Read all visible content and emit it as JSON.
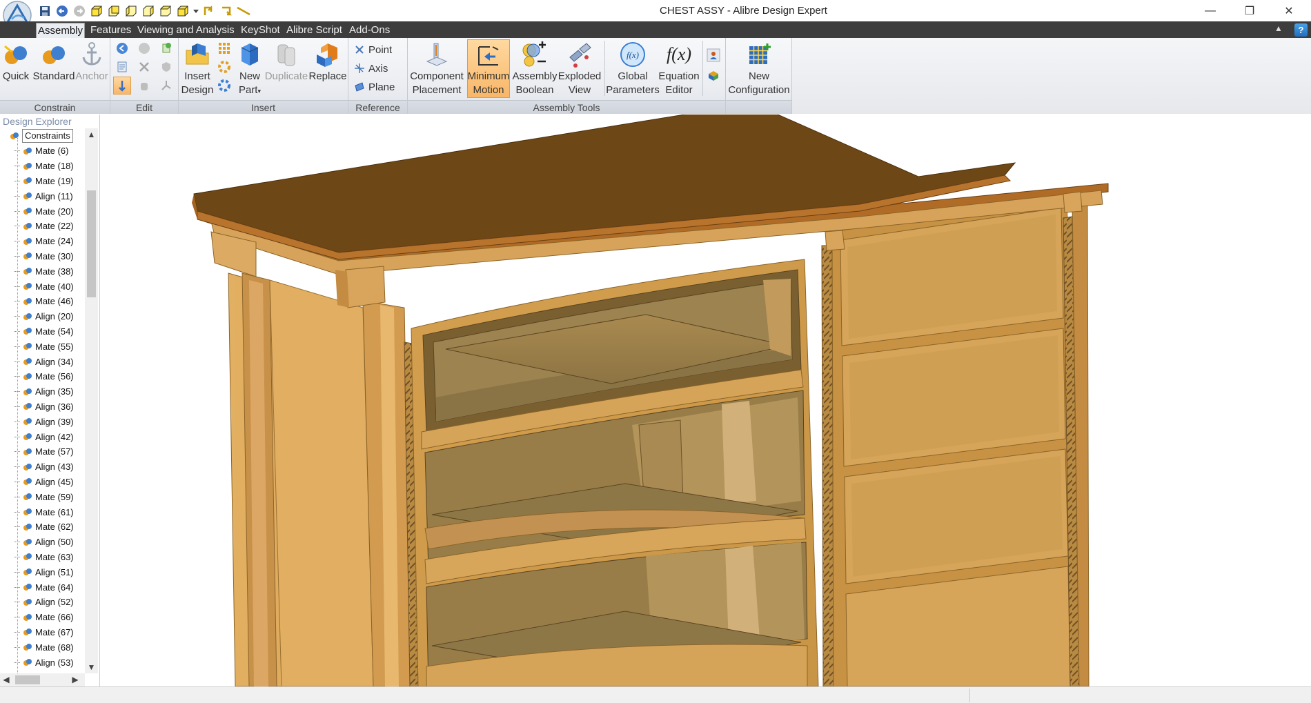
{
  "window": {
    "title": "CHEST ASSY - Alibre Design Expert",
    "minimize_icon": "minimize-icon",
    "restore_icon": "restore-icon",
    "close_icon": "close-icon"
  },
  "quick_access": [
    "save-icon",
    "undo-icon",
    "redo-icon",
    "view-front-icon",
    "view-back-icon",
    "view-left-icon",
    "view-right-icon",
    "view-top-icon",
    "view-iso-icon",
    "dropdown-icon",
    "sketch-icon",
    "arc-icon",
    "line-icon"
  ],
  "ribbon_tabs": [
    "Assembly",
    "Features",
    "Viewing and Analysis",
    "KeyShot",
    "Alibre Script",
    "Add-Ons"
  ],
  "active_tab": "Assembly",
  "ribbon": {
    "constrain": {
      "label": "Constrain",
      "quick": "Quick",
      "standard": "Standard",
      "anchor": "Anchor"
    },
    "edit": {
      "label": "Edit"
    },
    "insert": {
      "label": "Insert",
      "insert_design_1": "Insert",
      "insert_design_2": "Design",
      "new_part_1": "New",
      "new_part_2": "Part",
      "duplicate": "Duplicate",
      "replace": "Replace"
    },
    "reference": {
      "label": "Reference",
      "point": "Point",
      "axis": "Axis",
      "plane": "Plane"
    },
    "assembly_tools": {
      "label": "Assembly Tools",
      "component_placement_1": "Component",
      "component_placement_2": "Placement",
      "minimum_motion_1": "Minimum",
      "minimum_motion_2": "Motion",
      "assembly_boolean_1": "Assembly",
      "assembly_boolean_2": "Boolean",
      "exploded_view_1": "Exploded",
      "exploded_view_2": "View",
      "global_parameters_1": "Global",
      "global_parameters_2": "Parameters",
      "equation_editor_1": "Equation",
      "equation_editor_2": "Editor",
      "equation_icon_text": "f(x)"
    },
    "configuration": {
      "new_configuration_1": "New",
      "new_configuration_2": "Configuration"
    }
  },
  "explorer": {
    "title": "Design Explorer",
    "root": "Constraints",
    "items": [
      "Mate (6)",
      "Mate (18)",
      "Mate (19)",
      "Align (11)",
      "Mate (20)",
      "Mate (22)",
      "Mate (24)",
      "Mate (30)",
      "Mate (38)",
      "Mate (40)",
      "Mate (46)",
      "Align (20)",
      "Mate (54)",
      "Mate (55)",
      "Align (34)",
      "Mate (56)",
      "Align (35)",
      "Align (36)",
      "Align (39)",
      "Align (42)",
      "Mate (57)",
      "Align (43)",
      "Align (45)",
      "Mate (59)",
      "Mate (61)",
      "Mate (62)",
      "Align (50)",
      "Mate (63)",
      "Align (51)",
      "Mate (64)",
      "Align (52)",
      "Mate (66)",
      "Mate (67)",
      "Mate (68)",
      "Align (53)"
    ]
  },
  "viewport": {
    "model": "chest-of-drawers-3d-model",
    "colors": {
      "top": "#6f4816",
      "edge": "#b8742c",
      "frame": "#c99246",
      "panel": "#dba85c",
      "shadow": "#8a6a35"
    }
  },
  "colors": {
    "menubar": "#3d3d3d",
    "ribbon": "#eceef2",
    "pressed": "#f8b668"
  }
}
